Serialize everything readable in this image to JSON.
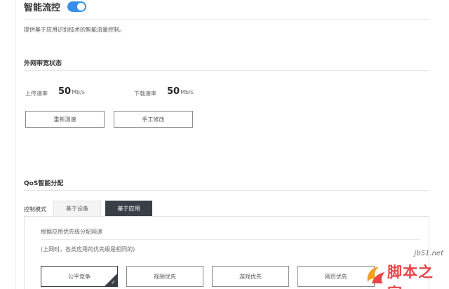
{
  "header": {
    "title": "智能流控",
    "toggle_on": true,
    "description": "提供基于应用识别技术的智能流量控制。"
  },
  "bandwidth": {
    "section_title": "外网带宽状态",
    "upload_label": "上传速率",
    "upload_value": "50",
    "upload_unit": "Mb/s",
    "download_label": "下载速率",
    "download_value": "50",
    "download_unit": "Mb/s",
    "retest_button": "重新测速",
    "manual_button": "手工修改"
  },
  "qos": {
    "section_title": "QoS智能分配",
    "control_mode_label": "控制模式",
    "tabs": [
      {
        "label": "基于设备",
        "active": false
      },
      {
        "label": "基于应用",
        "active": true
      }
    ],
    "panel_hint": "根据应用优先级分配网速",
    "panel_note": "(上网时，各类应用的优先级是相同的)",
    "options": [
      {
        "label": "公平竞争",
        "selected": true
      },
      {
        "label": "视频优先",
        "selected": false
      },
      {
        "label": "游戏优先",
        "selected": false
      },
      {
        "label": "网页优先",
        "selected": false
      }
    ]
  },
  "watermark": {
    "url": "jb51.net",
    "text": "脚本之家"
  },
  "colors": {
    "accent": "#3b8ee8",
    "dark": "#3a3f47",
    "watermark_red": "#e8464a"
  }
}
